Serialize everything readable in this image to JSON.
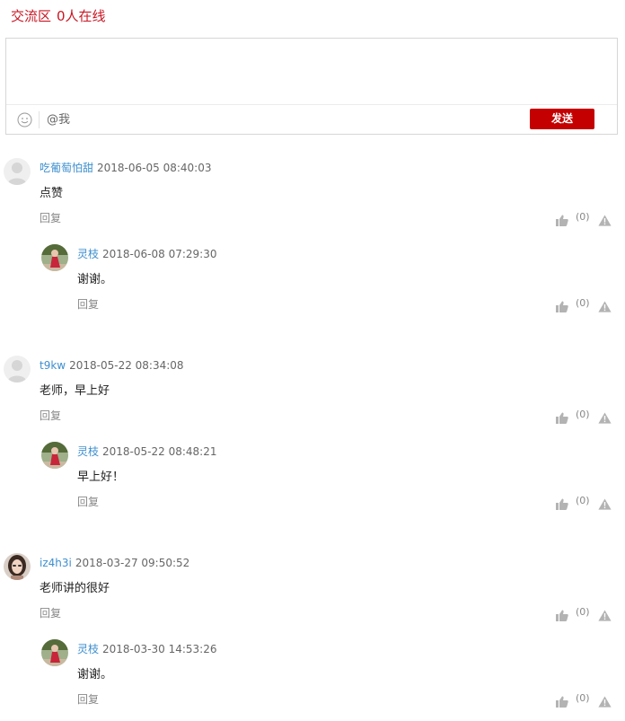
{
  "header": {
    "title": "交流区",
    "online": "0人在线"
  },
  "editor": {
    "value": "",
    "at_label": "@我",
    "send_label": "发送"
  },
  "comments": [
    {
      "author": "吃葡萄怕甜",
      "time": "2018-06-05 08:40:03",
      "text": "点赞",
      "reply_label": "回复",
      "likes": "(0)",
      "avatar": "default",
      "replies": [
        {
          "author": "灵枝",
          "time": "2018-06-08 07:29:30",
          "text": "谢谢。",
          "reply_label": "回复",
          "likes": "(0)",
          "avatar": "photo-outdoor"
        }
      ]
    },
    {
      "author": "t9kw",
      "time": "2018-05-22 08:34:08",
      "text": "老师，早上好",
      "reply_label": "回复",
      "likes": "(0)",
      "avatar": "default",
      "replies": [
        {
          "author": "灵枝",
          "time": "2018-05-22 08:48:21",
          "text": "早上好！",
          "reply_label": "回复",
          "likes": "(0)",
          "avatar": "photo-outdoor"
        }
      ]
    },
    {
      "author": "iz4h3i",
      "time": "2018-03-27 09:50:52",
      "text": "老师讲的很好",
      "reply_label": "回复",
      "likes": "(0)",
      "avatar": "photo-woman",
      "replies": [
        {
          "author": "灵枝",
          "time": "2018-03-30 14:53:26",
          "text": "谢谢。",
          "reply_label": "回复",
          "likes": "(0)",
          "avatar": "photo-outdoor"
        }
      ]
    }
  ],
  "colors": {
    "accent": "#c81623",
    "send_button": "#c40000",
    "author": "#3e8fcf",
    "icon": "#b3b3b3"
  }
}
